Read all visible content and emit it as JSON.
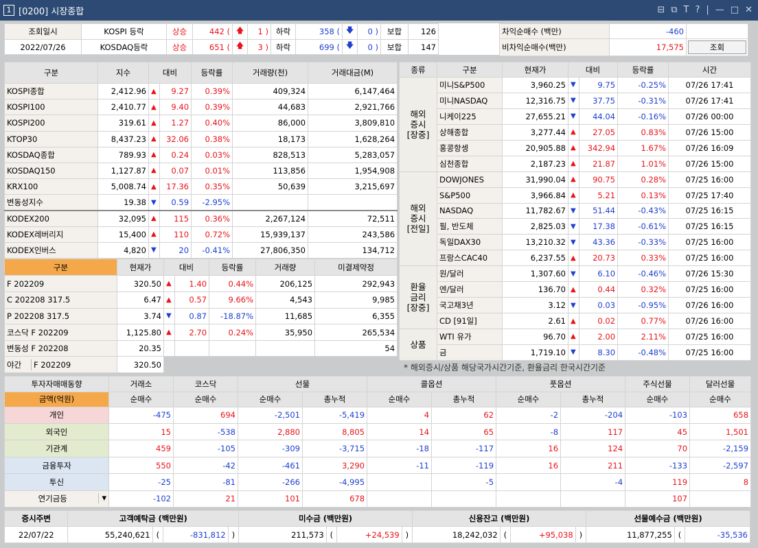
{
  "window": {
    "number": "1",
    "title": "[0200] 시장종합",
    "controls": [
      "⊟",
      "⧉",
      "T",
      "?",
      "|",
      "—",
      "□",
      "✕"
    ]
  },
  "top": {
    "label": "조회일시",
    "date": "2022/07/26",
    "rows": [
      {
        "name": "KOSPI 등락",
        "up_label": "상승",
        "up": "442 (",
        "up_arrow": "🡅",
        "up_n": "1 )",
        "down_label": "하락",
        "down": "358 (",
        "down_arrow": "🡇",
        "down_n": "0 )",
        "flat_label": "보합",
        "flat": "126"
      },
      {
        "name": "KOSDAQ등락",
        "up_label": "상승",
        "up": "651 (",
        "up_arrow": "🡅",
        "up_n": "3 )",
        "down_label": "하락",
        "down": "699 (",
        "down_arrow": "🡇",
        "down_n": "0 )",
        "flat_label": "보합",
        "flat": "147"
      }
    ],
    "arb": [
      {
        "label": "차익순매수  (백만)",
        "value": "-460"
      },
      {
        "label": "비차익순매수(백만)",
        "value": "17,575"
      }
    ],
    "query_button": "조회"
  },
  "index": {
    "headers": [
      "구분",
      "지수",
      "대비",
      "등락률",
      "거래량(천)",
      "거래대금(M)"
    ],
    "rows": [
      [
        "KOSPI종합",
        "2,412.96",
        "u",
        "9.27",
        "0.39%",
        "409,324",
        "6,147,464"
      ],
      [
        "KOSPI100",
        "2,410.77",
        "u",
        "9.40",
        "0.39%",
        "44,683",
        "2,921,766"
      ],
      [
        "KOSPI200",
        "319.61",
        "u",
        "1.27",
        "0.40%",
        "86,000",
        "3,809,810"
      ],
      [
        "KTOP30",
        "8,437.23",
        "u",
        "32.06",
        "0.38%",
        "18,173",
        "1,628,264"
      ],
      [
        "KOSDAQ종합",
        "789.93",
        "u",
        "0.24",
        "0.03%",
        "828,513",
        "5,283,057"
      ],
      [
        "KOSDAQ150",
        "1,127.87",
        "u",
        "0.07",
        "0.01%",
        "113,856",
        "1,954,908"
      ],
      [
        "KRX100",
        "5,008.74",
        "u",
        "17.36",
        "0.35%",
        "50,639",
        "3,215,697"
      ],
      [
        "변동성지수",
        "19.38",
        "d",
        "0.59",
        "-2.95%",
        "",
        ""
      ],
      [
        "KODEX200",
        "32,095",
        "u",
        "115",
        "0.36%",
        "2,267,124",
        "72,511"
      ],
      [
        "KODEX레버리지",
        "15,400",
        "u",
        "110",
        "0.72%",
        "15,939,137",
        "243,586"
      ],
      [
        "KODEX인버스",
        "4,820",
        "d",
        "20",
        "-0.41%",
        "27,806,350",
        "134,712"
      ]
    ]
  },
  "deriv": {
    "headers": [
      "구분",
      "현재가",
      "대비",
      "등락률",
      "거래량",
      "미결제약정"
    ],
    "rows": [
      [
        "F 202209",
        "320.50",
        "u",
        "1.40",
        "0.44%",
        "206,125",
        "292,943"
      ],
      [
        "C 202208 317.5",
        "6.47",
        "u",
        "0.57",
        "9.66%",
        "4,543",
        "9,985"
      ],
      [
        "P 202208 317.5",
        "3.74",
        "d",
        "0.87",
        "-18.87%",
        "11,685",
        "6,355"
      ],
      [
        "코스닥 F 202209",
        "1,125.80",
        "u",
        "2.70",
        "0.24%",
        "35,950",
        "265,534"
      ],
      [
        "변동성 F 202208",
        "20.35",
        "",
        "",
        "",
        "",
        "54"
      ]
    ],
    "night_label": "야간",
    "night_name": "F 202209",
    "night_price": "320.50"
  },
  "global": {
    "headers": [
      "종류",
      "구분",
      "현재가",
      "대비",
      "등락률",
      "시간"
    ],
    "groups": [
      {
        "label": "해외\n증시\n[장중]",
        "rows": [
          [
            "미니S&P500",
            "3,960.25",
            "d",
            "9.75",
            "-0.25%",
            "07/26 17:41"
          ],
          [
            "미니NASDAQ",
            "12,316.75",
            "d",
            "37.75",
            "-0.31%",
            "07/26 17:41"
          ],
          [
            "니케이225",
            "27,655.21",
            "d",
            "44.04",
            "-0.16%",
            "07/26 00:00"
          ],
          [
            "상해종합",
            "3,277.44",
            "u",
            "27.05",
            "0.83%",
            "07/26 15:00"
          ],
          [
            "홍콩항셍",
            "20,905.88",
            "u",
            "342.94",
            "1.67%",
            "07/26 16:09"
          ],
          [
            "심천종합",
            "2,187.23",
            "u",
            "21.87",
            "1.01%",
            "07/26 15:00"
          ]
        ]
      },
      {
        "label": "해외\n증시\n[전일]",
        "rows": [
          [
            "DOWJONES",
            "31,990.04",
            "u",
            "90.75",
            "0.28%",
            "07/25 16:00"
          ],
          [
            "S&P500",
            "3,966.84",
            "u",
            "5.21",
            "0.13%",
            "07/25 17:40"
          ],
          [
            "NASDAQ",
            "11,782.67",
            "d",
            "51.44",
            "-0.43%",
            "07/25 16:15"
          ],
          [
            "필, 반도체",
            "2,825.03",
            "d",
            "17.38",
            "-0.61%",
            "07/25 16:15"
          ],
          [
            "독일DAX30",
            "13,210.32",
            "d",
            "43.36",
            "-0.33%",
            "07/25 16:00"
          ],
          [
            "프랑스CAC40",
            "6,237.55",
            "u",
            "20.73",
            "0.33%",
            "07/25 16:00"
          ]
        ]
      },
      {
        "label": "환율\n금리\n[장중]",
        "rows": [
          [
            "원/달러",
            "1,307.60",
            "d",
            "6.10",
            "-0.46%",
            "07/26 15:30"
          ],
          [
            "엔/달러",
            "136.70",
            "u",
            "0.44",
            "0.32%",
            "07/25 16:00"
          ],
          [
            "국고채3년",
            "3.12",
            "d",
            "0.03",
            "-0.95%",
            "07/26 16:00"
          ],
          [
            "CD [91일]",
            "2.61",
            "u",
            "0.02",
            "0.77%",
            "07/26 16:00"
          ]
        ]
      },
      {
        "label": "상품",
        "rows": [
          [
            "WTI 유가",
            "96.70",
            "u",
            "2.00",
            "2.11%",
            "07/25 16:00"
          ],
          [
            "금",
            "1,719.10",
            "d",
            "8.30",
            "-0.48%",
            "07/25 16:00"
          ]
        ]
      }
    ],
    "note": "* 해외증시/상품 해당국가시간기준, 환율금리 한국시간기준"
  },
  "investor": {
    "h1": [
      "투자자매매동향",
      "거래소",
      "코스닥",
      "선물",
      "콜옵션",
      "풋옵션",
      "주식선물",
      "달러선물"
    ],
    "h2": [
      "금액(억원)",
      "순매수",
      "순매수",
      "순매수",
      "총누적",
      "순매수",
      "총누적",
      "순매수",
      "총누적",
      "순매수",
      "순매수"
    ],
    "rows": [
      [
        "개인",
        "-475",
        "694",
        "-2,501",
        "-5,419",
        "4",
        "62",
        "-2",
        "-204",
        "-103",
        "658"
      ],
      [
        "외국인",
        "15",
        "-538",
        "2,880",
        "8,805",
        "14",
        "65",
        "-8",
        "117",
        "45",
        "1,501"
      ],
      [
        "기관계",
        "459",
        "-105",
        "-309",
        "-3,715",
        "-18",
        "-117",
        "16",
        "124",
        "70",
        "-2,159"
      ],
      [
        "금융투자",
        "550",
        "-42",
        "-461",
        "3,290",
        "-11",
        "-119",
        "16",
        "211",
        "-133",
        "-2,597"
      ],
      [
        "투신",
        "-25",
        "-81",
        "-266",
        "-4,995",
        "",
        "-5",
        "",
        "-4",
        "119",
        "8"
      ],
      [
        "연기금등",
        "-102",
        "21",
        "101",
        "678",
        "",
        "",
        "",
        "",
        "107",
        ""
      ]
    ]
  },
  "bottom": {
    "headers": [
      "증시주변",
      "고객예탁금 (백만원)",
      "미수금 (백만원)",
      "신용잔고 (백만원)",
      "선물예수금 (백만원)"
    ],
    "date": "22/07/22",
    "values": [
      [
        "55,240,621",
        "-831,812"
      ],
      [
        "211,573",
        "+24,539"
      ],
      [
        "18,242,032",
        "+95,038"
      ],
      [
        "11,877,255",
        "-35,536"
      ]
    ]
  }
}
